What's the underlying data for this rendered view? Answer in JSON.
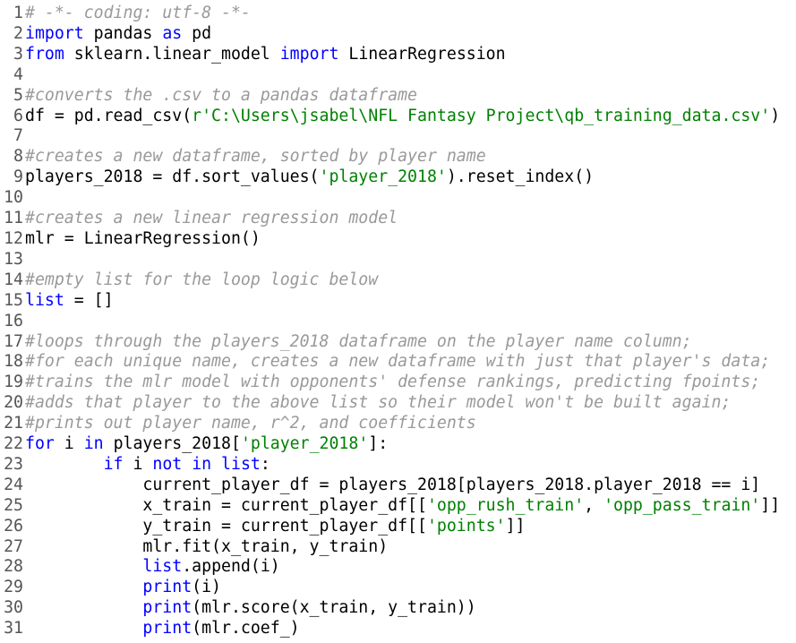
{
  "editor": {
    "colors": {
      "keyword": "#0000ff",
      "string": "#008000",
      "comment": "#999999",
      "text": "#000000",
      "line_number": "#555555"
    },
    "lines": [
      {
        "n": "1",
        "tokens": [
          {
            "t": "# -*- coding: utf-8 -*-",
            "c": "cmt"
          }
        ]
      },
      {
        "n": "2",
        "tokens": [
          {
            "t": "import",
            "c": "kw"
          },
          {
            "t": " pandas "
          },
          {
            "t": "as",
            "c": "kw"
          },
          {
            "t": " pd"
          }
        ]
      },
      {
        "n": "3",
        "tokens": [
          {
            "t": "from",
            "c": "kw"
          },
          {
            "t": " sklearn.linear_model "
          },
          {
            "t": "import",
            "c": "kw"
          },
          {
            "t": " LinearRegression"
          }
        ]
      },
      {
        "n": "4",
        "tokens": []
      },
      {
        "n": "5",
        "tokens": [
          {
            "t": "#converts the .csv to a pandas dataframe",
            "c": "cmt"
          }
        ]
      },
      {
        "n": "6",
        "tokens": [
          {
            "t": "df = pd.read_csv("
          },
          {
            "t": "r'C:\\Users\\jsabel\\NFL Fantasy Project\\qb_training_data.csv'",
            "c": "str"
          },
          {
            "t": ")"
          }
        ]
      },
      {
        "n": "7",
        "tokens": []
      },
      {
        "n": "8",
        "tokens": [
          {
            "t": "#creates a new dataframe, sorted by player name",
            "c": "cmt"
          }
        ]
      },
      {
        "n": "9",
        "tokens": [
          {
            "t": "players_2018 = df.sort_values("
          },
          {
            "t": "'player_2018'",
            "c": "str"
          },
          {
            "t": ").reset_index()"
          }
        ]
      },
      {
        "n": "10",
        "tokens": []
      },
      {
        "n": "11",
        "tokens": [
          {
            "t": "#creates a new linear regression model",
            "c": "cmt"
          }
        ]
      },
      {
        "n": "12",
        "tokens": [
          {
            "t": "mlr = LinearRegression()"
          }
        ]
      },
      {
        "n": "13",
        "tokens": []
      },
      {
        "n": "14",
        "tokens": [
          {
            "t": "#empty list for the loop logic below",
            "c": "cmt"
          }
        ]
      },
      {
        "n": "15",
        "tokens": [
          {
            "t": "list",
            "c": "kw"
          },
          {
            "t": " = []"
          }
        ]
      },
      {
        "n": "16",
        "tokens": []
      },
      {
        "n": "17",
        "tokens": [
          {
            "t": "#loops through the players_2018 dataframe on the player name column;",
            "c": "cmt"
          }
        ]
      },
      {
        "n": "18",
        "tokens": [
          {
            "t": "#for each unique name, creates a new dataframe with just that player's data;",
            "c": "cmt"
          }
        ]
      },
      {
        "n": "19",
        "tokens": [
          {
            "t": "#trains the mlr model with opponents' defense rankings, predicting fpoints;",
            "c": "cmt"
          }
        ]
      },
      {
        "n": "20",
        "tokens": [
          {
            "t": "#adds that player to the above list so their model won't be built again;",
            "c": "cmt"
          }
        ]
      },
      {
        "n": "21",
        "tokens": [
          {
            "t": "#prints out player name, r^2, and coefficients",
            "c": "cmt"
          }
        ]
      },
      {
        "n": "22",
        "tokens": [
          {
            "t": "for",
            "c": "kw"
          },
          {
            "t": " i "
          },
          {
            "t": "in",
            "c": "kw"
          },
          {
            "t": " players_2018["
          },
          {
            "t": "'player_2018'",
            "c": "str"
          },
          {
            "t": "]:"
          }
        ]
      },
      {
        "n": "23",
        "tokens": [
          {
            "t": "        "
          },
          {
            "t": "if",
            "c": "kw"
          },
          {
            "t": " i "
          },
          {
            "t": "not",
            "c": "kw"
          },
          {
            "t": " "
          },
          {
            "t": "in",
            "c": "kw"
          },
          {
            "t": " "
          },
          {
            "t": "list",
            "c": "kw"
          },
          {
            "t": ":"
          }
        ]
      },
      {
        "n": "24",
        "tokens": [
          {
            "t": "            current_player_df = players_2018[players_2018.player_2018 == i]"
          }
        ]
      },
      {
        "n": "25",
        "tokens": [
          {
            "t": "            x_train = current_player_df[["
          },
          {
            "t": "'opp_rush_train'",
            "c": "str"
          },
          {
            "t": ", "
          },
          {
            "t": "'opp_pass_train'",
            "c": "str"
          },
          {
            "t": "]]"
          }
        ]
      },
      {
        "n": "26",
        "tokens": [
          {
            "t": "            y_train = current_player_df[["
          },
          {
            "t": "'points'",
            "c": "str"
          },
          {
            "t": "]]"
          }
        ]
      },
      {
        "n": "27",
        "tokens": [
          {
            "t": "            mlr.fit(x_train, y_train)"
          }
        ]
      },
      {
        "n": "28",
        "tokens": [
          {
            "t": "            "
          },
          {
            "t": "list",
            "c": "kw"
          },
          {
            "t": ".append(i)"
          }
        ]
      },
      {
        "n": "29",
        "tokens": [
          {
            "t": "            "
          },
          {
            "t": "print",
            "c": "kw"
          },
          {
            "t": "(i)"
          }
        ]
      },
      {
        "n": "30",
        "tokens": [
          {
            "t": "            "
          },
          {
            "t": "print",
            "c": "kw"
          },
          {
            "t": "(mlr.score(x_train, y_train))"
          }
        ]
      },
      {
        "n": "31",
        "tokens": [
          {
            "t": "            "
          },
          {
            "t": "print",
            "c": "kw"
          },
          {
            "t": "(mlr.coef_)"
          }
        ]
      }
    ]
  }
}
